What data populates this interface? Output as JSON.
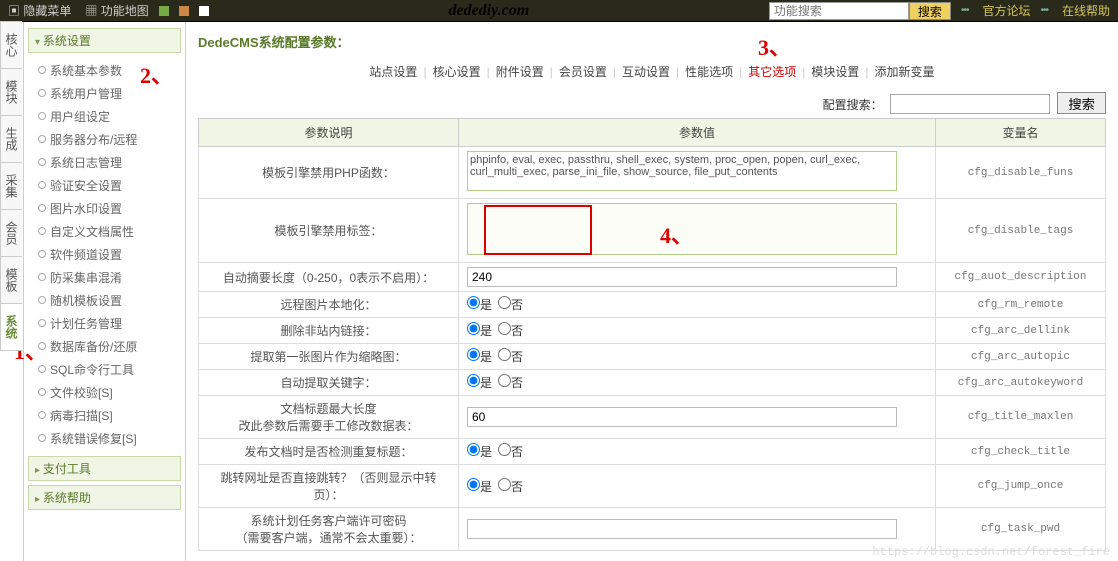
{
  "topbar": {
    "hide_menu": "隐藏菜单",
    "func_map": "功能地图",
    "brand": "dedediy.com",
    "search_placeholder": "功能搜索",
    "search_btn": "搜索",
    "forum": "官方论坛",
    "help": "在线帮助"
  },
  "vtabs": [
    "核心",
    "模块",
    "生成",
    "采集",
    "会员",
    "模板",
    "系统"
  ],
  "vtab_active": 6,
  "sidebar": {
    "groups": [
      {
        "title": "系统设置",
        "items": [
          "系统基本参数",
          "系统用户管理",
          "用户组设定",
          "服务器分布/远程",
          "系统日志管理",
          "验证安全设置",
          "图片水印设置",
          "自定义文档属性",
          "软件频道设置",
          "防采集串混淆",
          "随机模板设置",
          "计划任务管理",
          "数据库备份/还原",
          "SQL命令行工具",
          "文件校验[S]",
          "病毒扫描[S]",
          "系统错误修复[S]"
        ]
      },
      {
        "title": "支付工具",
        "collapsed": true
      },
      {
        "title": "系统帮助",
        "collapsed": true
      }
    ]
  },
  "page": {
    "title": "DedeCMS系统配置参数：",
    "tabs": [
      "站点设置",
      "核心设置",
      "附件设置",
      "会员设置",
      "互动设置",
      "性能选项",
      "其它选项",
      "模块设置",
      "添加新变量"
    ],
    "tab_active": 6,
    "search_label": "配置搜索：",
    "search_btn": "搜索",
    "th": {
      "desc": "参数说明",
      "value": "参数值",
      "var": "变量名"
    },
    "rows": [
      {
        "label": "模板引擎禁用PHP函数：",
        "type": "textarea",
        "value": "phpinfo, eval, exec, passthru, shell_exec, system, proc_open, popen, curl_exec, curl_multi_exec, parse_ini_file, show_source, file_put_contents",
        "var": "cfg_disable_funs",
        "tall": true
      },
      {
        "label": "模板引擎禁用标签：",
        "type": "textarea",
        "value": "",
        "var": "cfg_disable_tags",
        "xtall": true
      },
      {
        "label": "自动摘要长度（0-250，0表示不启用）：",
        "type": "text",
        "value": "240",
        "var": "cfg_auot_description"
      },
      {
        "label": "远程图片本地化：",
        "type": "radio",
        "value": "是",
        "var": "cfg_rm_remote"
      },
      {
        "label": "删除非站内链接：",
        "type": "radio",
        "value": "是",
        "var": "cfg_arc_dellink"
      },
      {
        "label": "提取第一张图片作为缩略图：",
        "type": "radio",
        "value": "是",
        "var": "cfg_arc_autopic"
      },
      {
        "label": "自动提取关键字：",
        "type": "radio",
        "value": "是",
        "var": "cfg_arc_autokeyword"
      },
      {
        "label": "文档标题最大长度\n改此参数后需要手工修改数据表：",
        "type": "text",
        "value": "60",
        "var": "cfg_title_maxlen"
      },
      {
        "label": "发布文档时是否检测重复标题：",
        "type": "radio",
        "value": "是",
        "var": "cfg_check_title"
      },
      {
        "label": "跳转网址是否直接跳转？（否则显示中转页）：",
        "type": "radio",
        "value": "是",
        "var": "cfg_jump_once"
      },
      {
        "label": "系统计划任务客户端许可密码\n（需要客户端，通常不会太重要）：",
        "type": "text",
        "value": "",
        "var": "cfg_task_pwd"
      }
    ],
    "radio_yes": "是",
    "radio_no": "否"
  },
  "annotations": {
    "a1": "1、",
    "a2": "2、",
    "a3": "3、",
    "a4": "4、"
  },
  "watermark": "https://blog.csdn.net/forest_fire"
}
